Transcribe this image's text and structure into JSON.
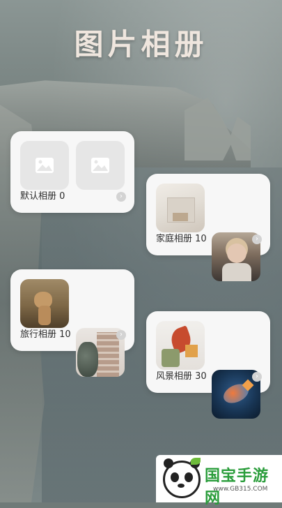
{
  "app": {
    "title": "图片相册"
  },
  "albums": [
    {
      "name": "默认相册",
      "count": "0",
      "label": "默认相册 0",
      "thumbs": [
        "image-placeholder",
        "image-placeholder"
      ]
    },
    {
      "name": "家庭相册",
      "count": "10",
      "label": "家庭相册 10",
      "thumbs": [
        "room-interior",
        "girl-with-hat"
      ]
    },
    {
      "name": "旅行相册",
      "count": "10",
      "label": "旅行相册 10",
      "thumbs": [
        "lion",
        "building"
      ]
    },
    {
      "name": "风景相册",
      "count": "30",
      "label": "风景相册 30",
      "thumbs": [
        "autumn-leaves",
        "koi-fish"
      ]
    }
  ],
  "watermark": {
    "brand": "国宝手游网",
    "site": "www.GB315.COM"
  },
  "colors": {
    "title": "#efe6de",
    "card": "#f7f7f7",
    "brand": "#2a9d3b"
  }
}
